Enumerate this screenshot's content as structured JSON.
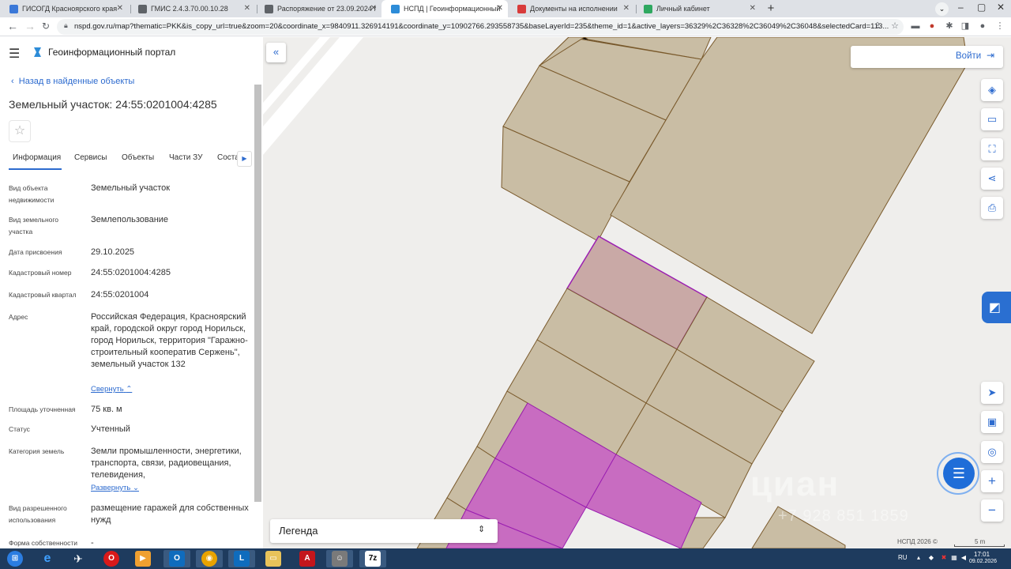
{
  "browser": {
    "tabs": [
      {
        "title": "ГИСОГД Красноярского края",
        "favicon_color": "#3b78d8"
      },
      {
        "title": "ГМИС 2.4.3.70.00.10.28",
        "favicon_color": "#5f6368"
      },
      {
        "title": "Распоряжение от 23.09.2024 №",
        "favicon_color": "#5f6368"
      },
      {
        "title": "НСПД | Геоинформационный п",
        "favicon_color": "#2d8cd8",
        "active": true
      },
      {
        "title": "Документы на исполнении",
        "favicon_color": "#d83b3b"
      },
      {
        "title": "Личный кабинет",
        "favicon_color": "#2fa860"
      }
    ],
    "new_tab": "+",
    "url": "nspd.gov.ru/map?thematic=PKK&is_copy_url=true&zoom=20&coordinate_x=9840911.326914191&coordinate_y=10902766.293558735&baseLayerId=235&theme_id=1&active_layers=36329%2C36328%2C36049%2C36048&selectedCard=113..."
  },
  "panel": {
    "portal_title": "Геоинформационный портал",
    "back_link": "Назад в найденные объекты",
    "title": "Земельный участок: 24:55:0201004:4285",
    "tabs": [
      "Информация",
      "Сервисы",
      "Объекты",
      "Части ЗУ",
      "Соста"
    ],
    "fields": [
      {
        "label": "Вид объекта недвижимости",
        "value": "Земельный участок"
      },
      {
        "label": "Вид земельного участка",
        "value": "Землепользование"
      },
      {
        "label": "Дата присвоения",
        "value": "29.10.2025"
      },
      {
        "label": "Кадастровый номер",
        "value": "24:55:0201004:4285"
      },
      {
        "label": "Кадастровый квартал",
        "value": "24:55:0201004"
      },
      {
        "label": "Адрес",
        "value": "Российская Федерация, Красноярский край, городской округ город Норильск, город Норильск, территория \"Гаражно-строительный кооператив Сержень\", земельный участок 132"
      },
      {
        "label": "Площадь уточненная",
        "value": "75 кв. м"
      },
      {
        "label": "Статус",
        "value": "Учтенный"
      },
      {
        "label": "Категория земель",
        "value": "Земли промышленности, энергетики, транспорта, связи, радиовещания, телевидения,"
      },
      {
        "label": "Вид разрешенного использования",
        "value": "размещение гаражей для собственных нужд"
      },
      {
        "label": "Форма собственности",
        "value": "-"
      }
    ],
    "address_toggle": "Свернуть",
    "category_toggle": "Развернуть"
  },
  "map": {
    "login": "Войти",
    "legend": "Легенда",
    "attribution": "НСПД 2026 ©",
    "scale": "5 m",
    "watermark": "циан",
    "watermark_number": "+7 928 851 1859",
    "colors": {
      "parcel_fill": "#c9bda4",
      "parcel_stroke": "#7a5a2c",
      "selected_fill": "#c9a9a6",
      "selected_stroke": "#9b1fb1",
      "highlight_fill": "#c86cc1",
      "accent": "#2d6bcf"
    }
  },
  "taskbar": {
    "language": "RU",
    "time": "17:01",
    "date": "09.02.2026"
  }
}
